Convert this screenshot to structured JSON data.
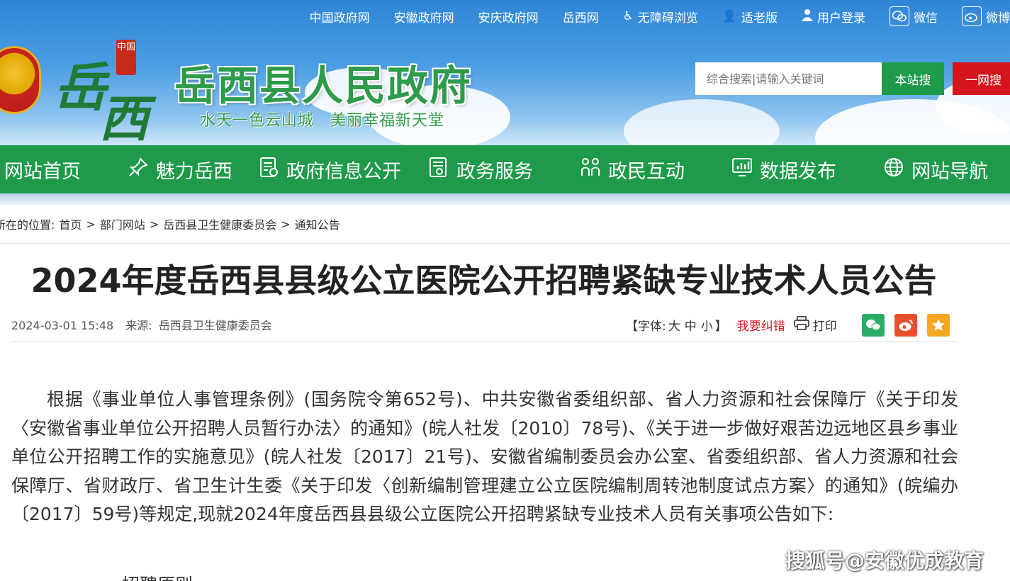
{
  "topbar": {
    "links": [
      "中国政府网",
      "安徽政府网",
      "安庆政府网",
      "岳西网"
    ],
    "accessibility": "无障碍浏览",
    "elder": "适老版",
    "login": "用户登录",
    "wechat": "微信",
    "weibo": "微博"
  },
  "header": {
    "calligraphy_1": "岳",
    "calligraphy_2": "西",
    "seal_text": "中国",
    "site_title": "岳西县人民政府",
    "slogan": "水天一色云山城　美丽幸福新天堂",
    "search_placeholder": "综合搜索|请输入关键词",
    "search_site": "本站搜",
    "search_all": "一网搜"
  },
  "nav": {
    "items": [
      {
        "label": "网站首页",
        "icon": "home"
      },
      {
        "label": "魅力岳西",
        "icon": "pin-icon"
      },
      {
        "label": "政府信息公开",
        "icon": "document-list-icon"
      },
      {
        "label": "政务服务",
        "icon": "service-icon"
      },
      {
        "label": "政民互动",
        "icon": "people-icon"
      },
      {
        "label": "数据发布",
        "icon": "chart-monitor-icon"
      },
      {
        "label": "网站导航",
        "icon": "globe-icon"
      }
    ]
  },
  "breadcrumb": {
    "prefix": "所在的位置:",
    "items": [
      "首页",
      "部门网站",
      "岳西县卫生健康委员会",
      "通知公告"
    ],
    "separator": ">"
  },
  "article": {
    "title": "2024年度岳西县县级公立医院公开招聘紧缺专业技术人员公告",
    "date": "2024-03-01 15:48",
    "source_label": "来源:",
    "source": "岳西县卫生健康委员会",
    "font_label_open": "【字体:",
    "font_large": "大",
    "font_medium": "中",
    "font_small": "小",
    "font_label_close": "】",
    "error_report": "我要纠错",
    "print": "打印",
    "body": "根据《事业单位人事管理条例》(国务院令第652号)、中共安徽省委组织部、省人力资源和社会保障厅《关于印发〈安徽省事业单位公开招聘人员暂行办法〉的通知》(皖人社发〔2010〕78号)、《关于进一步做好艰苦边远地区县乡事业单位公开招聘工作的实施意见》(皖人社发〔2017〕21号)、安徽省编制委员会办公室、省委组织部、省人力资源和社会保障厅、省财政厅、省卫生计生委《关于印发〈创新编制管理建立公立医院编制周转池制度试点方案〉的通知》(皖编办〔2017〕59号)等规定,现就2024年度岳西县县级公立医院公开招聘紧缺专业技术人员有关事项公告如下:",
    "subheading": "一、招聘原则"
  },
  "share": {
    "wechat_color": "#2aae67",
    "weibo_color": "#e6512d",
    "qzone_color": "#f5a623"
  },
  "watermark": "搜狐号@安徽优成教育",
  "colors": {
    "nav_green": "#1e9a4a",
    "title_green": "#2e9b4a",
    "search_red": "#d4151c"
  }
}
